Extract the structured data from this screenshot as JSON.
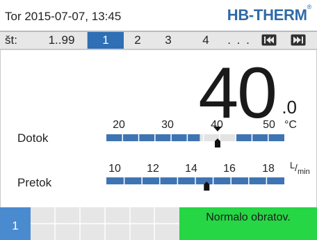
{
  "header": {
    "datetime": "Tor  2015-07-07, 13:45",
    "brand": "HB-THERM",
    "brand_mark": "®"
  },
  "tabs": {
    "label": "št:",
    "range": "1..99",
    "items": [
      "1",
      "2",
      "3",
      "4"
    ],
    "more": ". . .",
    "active": "1",
    "nav_prev_icon": "skip-back-icon",
    "nav_next_icon": "skip-forward-icon"
  },
  "display": {
    "value_int": "40",
    "value_dec": ".0"
  },
  "dotok": {
    "label": "Dotok",
    "ticks": [
      "20",
      "30",
      "40",
      "50"
    ],
    "unit": "°C",
    "scale_min": 15,
    "scale_max": 55,
    "setpoint": 40,
    "actual": 40,
    "band_low": 36,
    "band_high": 44
  },
  "pretok": {
    "label": "Pretok",
    "ticks": [
      "10",
      "12",
      "14",
      "16",
      "18"
    ],
    "unit_top": "L",
    "unit_bottom": "min",
    "scale_min": 8.5,
    "scale_max": 19.5,
    "actual": 14.7
  },
  "footer": {
    "unit_number": "1",
    "status": "Normalo obratov."
  },
  "colors": {
    "accent": "#2e6fb5",
    "bar": "#3f74b3",
    "band": "#e3e3e3",
    "status_ok": "#26d645",
    "unit_tab": "#4a8bd0"
  }
}
